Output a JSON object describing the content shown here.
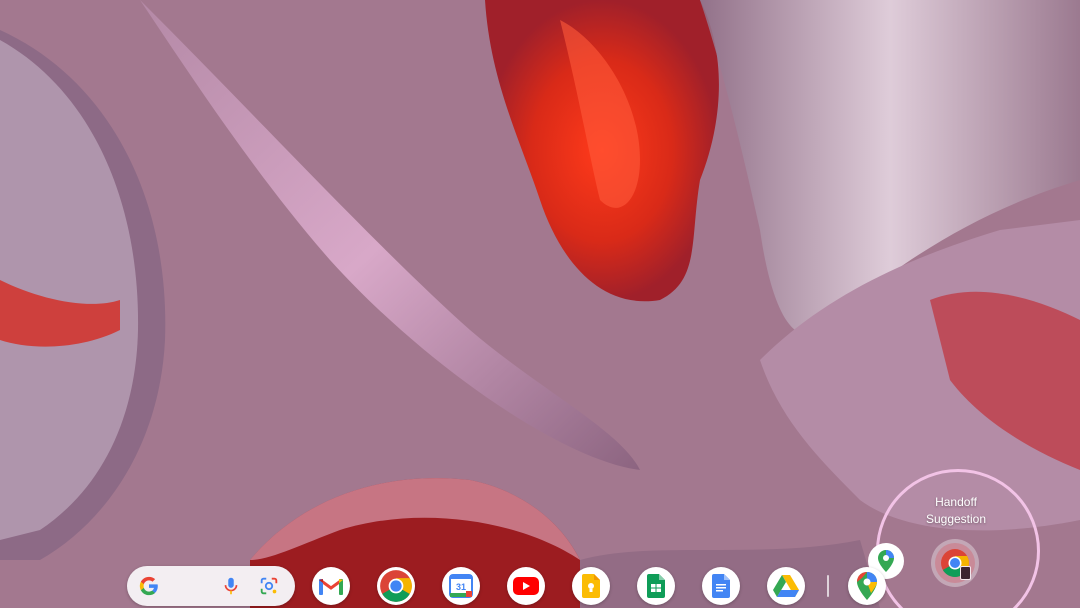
{
  "handoff": {
    "label": "Handoff\nSuggestion",
    "label_line1": "Handoff",
    "label_line2": "Suggestion",
    "icon": "chrome-icon"
  },
  "shelf": {
    "search": {
      "icons": [
        "google-g-icon",
        "microphone-icon",
        "google-lens-icon"
      ]
    },
    "apps": [
      {
        "name": "gmail",
        "icon": "gmail-icon"
      },
      {
        "name": "chrome",
        "icon": "chrome-icon"
      },
      {
        "name": "calendar",
        "icon": "calendar-icon",
        "date": "31"
      },
      {
        "name": "youtube",
        "icon": "youtube-icon"
      },
      {
        "name": "keep",
        "icon": "keep-icon"
      },
      {
        "name": "sheets",
        "icon": "sheets-icon"
      },
      {
        "name": "docs",
        "icon": "docs-icon"
      },
      {
        "name": "drive",
        "icon": "drive-icon"
      },
      {
        "name": "maps",
        "icon": "maps-icon"
      }
    ]
  },
  "colors": {
    "ring": "#f2c3e6",
    "wallpaper_base": "#9a6f8c",
    "accent_red": "#e8321c"
  }
}
